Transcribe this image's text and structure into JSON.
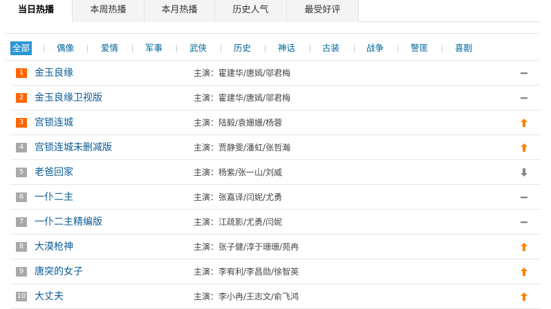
{
  "tabs": [
    {
      "label": "当日热播",
      "active": true
    },
    {
      "label": "本周热播",
      "active": false
    },
    {
      "label": "本月热播",
      "active": false
    },
    {
      "label": "历史人气",
      "active": false
    },
    {
      "label": "最受好评",
      "active": false
    }
  ],
  "categories": [
    "全部",
    "偶像",
    "爱情",
    "军事",
    "武侠",
    "历史",
    "神话",
    "古装",
    "战争",
    "警匪",
    "喜剧"
  ],
  "active_category": "全部",
  "cast_prefix": "主演：",
  "colors": {
    "accent": "#2a97d7",
    "top_rank": "#ff6600",
    "rank": "#a9a9a9",
    "up": "#ff7f00",
    "down": "#888888",
    "flat": "#888888"
  },
  "rows": [
    {
      "rank": "1",
      "title": "金玉良缘",
      "cast": "霍建华/唐嫣/邬君梅",
      "trend": "flat"
    },
    {
      "rank": "2",
      "title": "金玉良缘卫视版",
      "cast": "霍建华/唐嫣/邬君梅",
      "trend": "flat"
    },
    {
      "rank": "3",
      "title": "宫锁连城",
      "cast": "陆毅/袁姗姗/杨蓉",
      "trend": "up"
    },
    {
      "rank": "4",
      "title": "宫锁连城未删减版",
      "cast": "贾静雯/潘虹/张哲瀚",
      "trend": "up"
    },
    {
      "rank": "5",
      "title": "老爸回家",
      "cast": "杨紫/张一山/刘威",
      "trend": "down"
    },
    {
      "rank": "6",
      "title": "一仆二主",
      "cast": "张嘉译/闫妮/尤勇",
      "trend": "flat"
    },
    {
      "rank": "7",
      "title": "一仆二主精编版",
      "cast": "江疏影/尤勇/闫妮",
      "trend": "flat"
    },
    {
      "rank": "8",
      "title": "大漠枪神",
      "cast": "张子健/淳于珊珊/苑冉",
      "trend": "up"
    },
    {
      "rank": "9",
      "title": "唐突的女子",
      "cast": "李宥利/李昌勋/徐智英",
      "trend": "up"
    },
    {
      "rank": "10",
      "title": "大丈夫",
      "cast": "李小冉/王志文/俞飞鸿",
      "trend": "up"
    }
  ]
}
